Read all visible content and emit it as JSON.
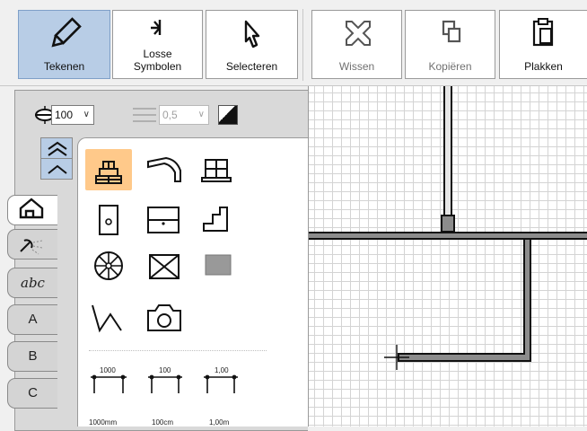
{
  "toolbar": {
    "draw": "Tekenen",
    "loose_symbols_line1": "Losse",
    "loose_symbols_line2": "Symbolen",
    "select": "Selecteren",
    "delete": "Wissen",
    "copy": "Kopiëren",
    "paste": "Plakken"
  },
  "options": {
    "height_value": "100",
    "line_width_value": "0,5"
  },
  "tabs": {
    "a": "A",
    "b": "B",
    "c": "C",
    "text_tab": "abc"
  },
  "dimensions": {
    "dim1": "1000",
    "dim2": "100",
    "dim3": "1,00",
    "dim4": "1000mm",
    "dim5": "100cm",
    "dim6": "1,00m"
  },
  "colors": {
    "active_tool": "#b8cde6",
    "selected_symbol": "#ffc98a",
    "grid": "#d4d4d4",
    "wall": "#8c8c8c"
  }
}
